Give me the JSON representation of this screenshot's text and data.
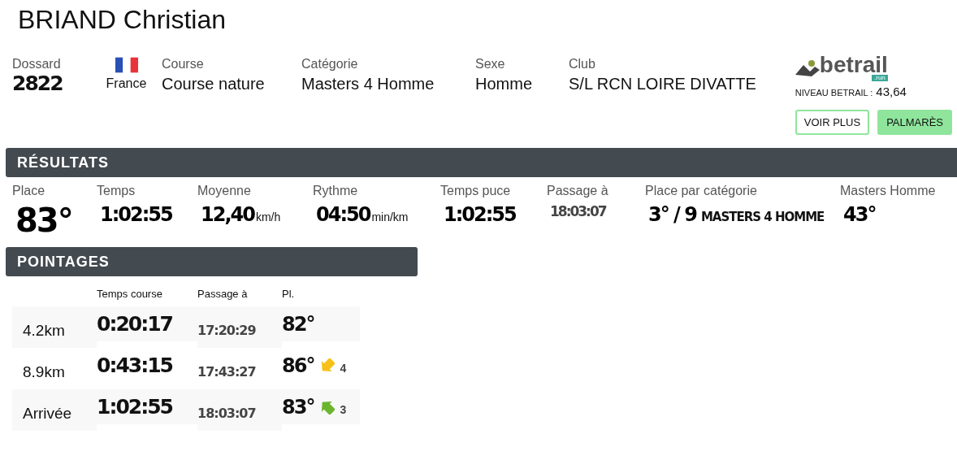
{
  "athlete": {
    "name": "BRIAND Christian"
  },
  "info": [
    {
      "label": "Dossard",
      "value": "2822",
      "kind": "bib"
    },
    {
      "label": "France",
      "kind": "flag"
    },
    {
      "label": "Course",
      "value": "Course nature",
      "kind": "text"
    },
    {
      "label": "Catégorie",
      "value": "Masters 4 Homme",
      "kind": "text"
    },
    {
      "label": "Sexe",
      "value": "Homme",
      "kind": "text"
    },
    {
      "label": "Club",
      "value": "S/L RCN LOIRE DIVATTE",
      "kind": "text"
    }
  ],
  "betrail": {
    "logo": "betrail",
    "logo_suffix": ".run",
    "level_label": "NIVEAU BETRAIL :",
    "level": "43,64",
    "buttons": [
      {
        "label": "VOIR PLUS",
        "kind": "outline"
      },
      {
        "label": "PALMARÈS",
        "kind": "filled"
      }
    ]
  },
  "results": {
    "title": "RÉSULTATS",
    "items": [
      {
        "label": "Place",
        "value": "83°",
        "kind": "big"
      },
      {
        "label": "Temps",
        "value": "1:02:55",
        "kind": "main"
      },
      {
        "label": "Moyenne",
        "value": "12,40",
        "unit": "km/h",
        "kind": "main"
      },
      {
        "label": "Rythme",
        "value": "04:50",
        "unit": "min/km",
        "kind": "main"
      },
      {
        "label": "Temps puce",
        "value": "1:02:55",
        "kind": "main"
      },
      {
        "label": "Passage à",
        "value": "18:03:07",
        "kind": "minor"
      },
      {
        "label": "Place par catégorie",
        "value": "3° / 9",
        "unit": "MASTERS 4 HOMME",
        "kind": "category"
      },
      {
        "label": "Masters Homme",
        "value": "43°",
        "kind": "main"
      }
    ]
  },
  "checkpoints": {
    "title": "POINTAGES",
    "columns": [
      "Temps course",
      "Passage à",
      "Pl."
    ],
    "rows": [
      {
        "name": "4.2km",
        "time": "0:20:17",
        "passage": "17:20:29",
        "place": "82°",
        "kind": "plain"
      },
      {
        "name": "8.9km",
        "time": "0:43:15",
        "passage": "17:43:27",
        "place": "86°",
        "kind": "lost",
        "change": "4"
      },
      {
        "name": "Arrivée",
        "time": "1:02:55",
        "passage": "18:03:07",
        "place": "83°",
        "kind": "gained",
        "change": "3"
      }
    ]
  }
}
